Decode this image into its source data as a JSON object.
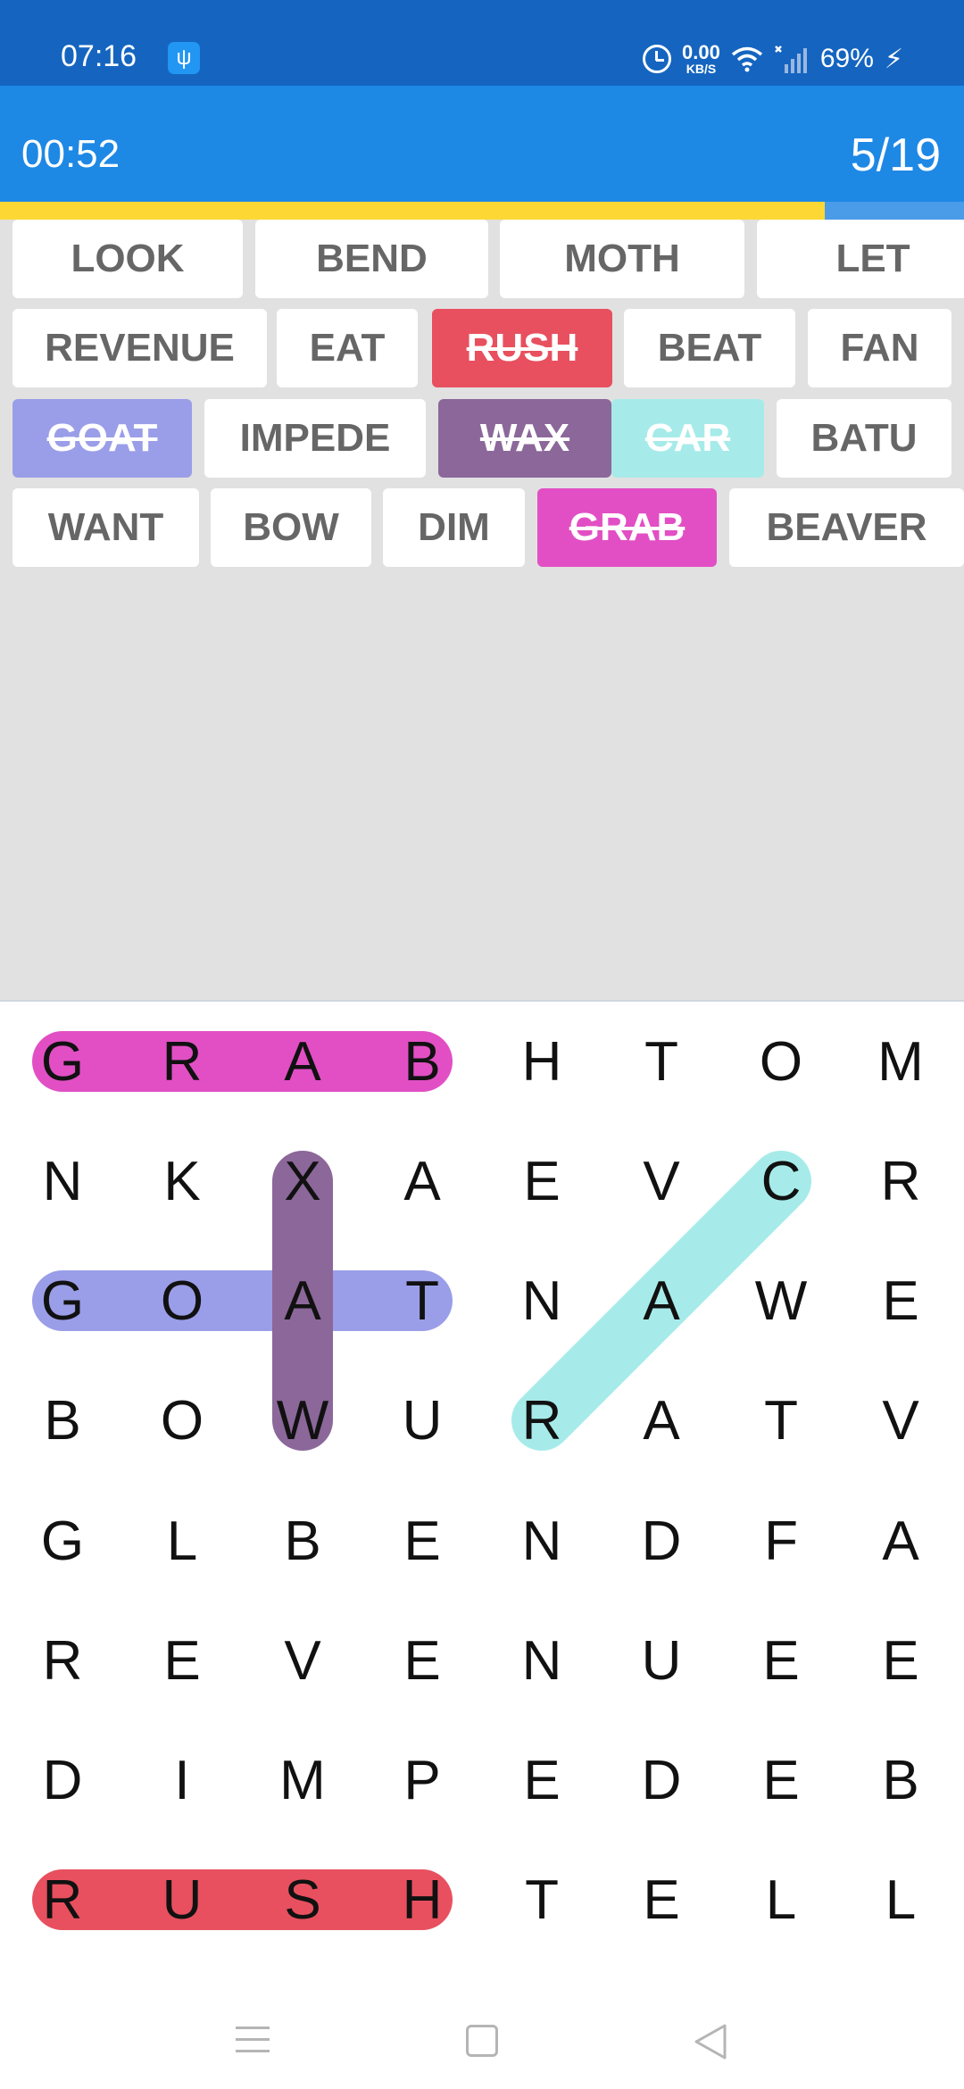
{
  "status_bar": {
    "time": "07:16",
    "usb_icon": "usb-icon",
    "net_speed_value": "0.00",
    "net_speed_unit": "KB/S",
    "battery_percent": "69%",
    "icons": [
      "alarm-icon",
      "wifi-icon",
      "signal-icon",
      "charging-bolt-icon"
    ]
  },
  "header": {
    "timer": "00:52",
    "progress": "5/19",
    "progress_fraction": 0.856
  },
  "words": [
    [
      {
        "text": "LOOK",
        "found": false
      },
      {
        "text": "BEND",
        "found": false
      },
      {
        "text": "MOTH",
        "found": false
      },
      {
        "text": "LET",
        "found": false
      }
    ],
    [
      {
        "text": "REVENUE",
        "found": false
      },
      {
        "text": "EAT",
        "found": false
      },
      {
        "text": "RUSH",
        "found": true,
        "color": "#e8505f"
      },
      {
        "text": "BEAT",
        "found": false
      },
      {
        "text": "FAN",
        "found": false
      }
    ],
    [
      {
        "text": "GOAT",
        "found": true,
        "color": "#9a9ee8"
      },
      {
        "text": "IMPEDE",
        "found": false
      },
      {
        "text": "WAX",
        "found": true,
        "color": "#8b679a"
      },
      {
        "text": "CAR",
        "found": true,
        "color": "#a6ebe9"
      },
      {
        "text": "BATU",
        "found": false
      }
    ],
    [
      {
        "text": "WANT",
        "found": false
      },
      {
        "text": "BOW",
        "found": false
      },
      {
        "text": "DIM",
        "found": false
      },
      {
        "text": "GRAB",
        "found": true,
        "color": "#e24fc4"
      },
      {
        "text": "BEAVER",
        "found": false
      }
    ]
  ],
  "grid": [
    [
      "G",
      "R",
      "A",
      "B",
      "H",
      "T",
      "O",
      "M"
    ],
    [
      "N",
      "K",
      "X",
      "A",
      "E",
      "V",
      "C",
      "R"
    ],
    [
      "G",
      "O",
      "A",
      "T",
      "N",
      "A",
      "W",
      "E"
    ],
    [
      "B",
      "O",
      "W",
      "U",
      "R",
      "A",
      "T",
      "V"
    ],
    [
      "G",
      "L",
      "B",
      "E",
      "N",
      "D",
      "F",
      "A"
    ],
    [
      "R",
      "E",
      "V",
      "E",
      "N",
      "U",
      "E",
      "E"
    ],
    [
      "D",
      "I",
      "M",
      "P",
      "E",
      "D",
      "E",
      "B"
    ],
    [
      "R",
      "U",
      "S",
      "H",
      "T",
      "E",
      "L",
      "L"
    ]
  ],
  "found_paths": [
    {
      "word": "GRAB",
      "color": "#e24fc4",
      "start": [
        0,
        0
      ],
      "end": [
        0,
        3
      ]
    },
    {
      "word": "GOAT",
      "color": "#9a9ee8",
      "start": [
        2,
        0
      ],
      "end": [
        2,
        3
      ]
    },
    {
      "word": "WAX",
      "color": "#8b679a",
      "start": [
        1,
        2
      ],
      "end": [
        3,
        2
      ]
    },
    {
      "word": "CAR",
      "color": "#a6ebe9",
      "start": [
        1,
        6
      ],
      "end": [
        3,
        4
      ]
    },
    {
      "word": "RUSH",
      "color": "#e8505f",
      "start": [
        7,
        0
      ],
      "end": [
        7,
        3
      ]
    }
  ],
  "nav_icons": [
    "menu-icon",
    "home-icon",
    "back-icon"
  ]
}
